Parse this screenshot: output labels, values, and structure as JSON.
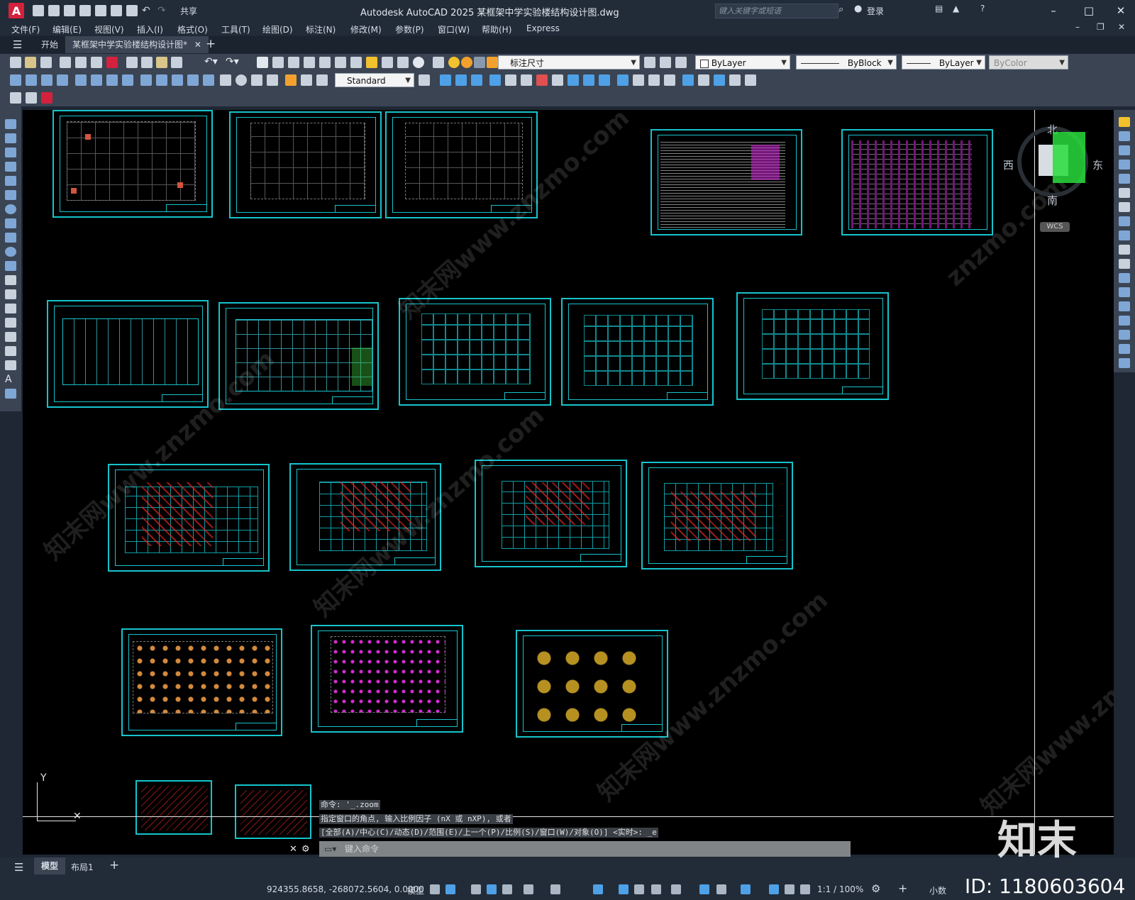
{
  "app": {
    "logo_letter": "A",
    "title": "Autodesk AutoCAD 2025    某框架中学实验楼结构设计图.dwg",
    "search_placeholder": "键入关键字或短语",
    "login": "登录",
    "share": "共享"
  },
  "menu": [
    "文件(F)",
    "编辑(E)",
    "视图(V)",
    "插入(I)",
    "格式(O)",
    "工具(T)",
    "绘图(D)",
    "标注(N)",
    "修改(M)",
    "参数(P)",
    "窗口(W)",
    "帮助(H)",
    "Express"
  ],
  "tabs": {
    "start": "开始",
    "document": "某框架中学实验楼结构设计图*"
  },
  "properties": {
    "dim_style": "标注尺寸",
    "layer": "ByLayer",
    "linetype": "ByBlock",
    "lineweight": "ByLayer",
    "color": "ByColor",
    "text_style": "Standard"
  },
  "viewcube": {
    "north": "北",
    "south": "南",
    "east": "东",
    "west": "西",
    "wcs": "WCS"
  },
  "ucs": {
    "y_label": "Y"
  },
  "command": {
    "history": [
      "命令: '_.zoom",
      "指定窗口的角点, 输入比例因子 (nX 或 nXP), 或者",
      "[全部(A)/中心(C)/动态(D)/范围(E)/上一个(P)/比例(S)/窗口(W)/对象(O)] <实时>: _e"
    ],
    "input_placeholder": "键入命令"
  },
  "layout_tabs": {
    "model": "模型",
    "layout1": "布局1",
    "add": "+"
  },
  "status": {
    "coords": "924355.8658, -268072.5604, 0.0000",
    "model": "模型",
    "scale": "1:1 / 100%",
    "units": "小数"
  },
  "overlay": {
    "brand": "知末",
    "id": "ID: 1180603604"
  },
  "watermarks": [
    "知末网www.znzmo.com",
    "知末网www.znzmo.com",
    "知末网www.znzmo.com",
    "知末网www.znzmo.com",
    "znzmo.com",
    "知末网www.znzmo.com"
  ],
  "colors": {
    "sheet_border": "#16c3cc",
    "canvas": "#000000",
    "accent_red": "#d4213d"
  }
}
